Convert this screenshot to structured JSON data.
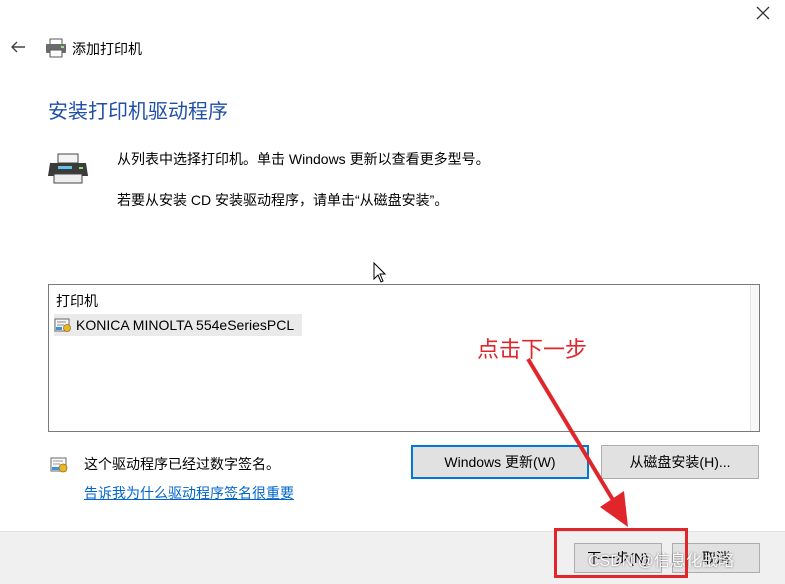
{
  "window": {
    "title": "添加打印机"
  },
  "page": {
    "heading": "安装打印机驱动程序",
    "description_line1": "从列表中选择打印机。单击 Windows 更新以查看更多型号。",
    "description_line2": "若要从安装 CD 安装驱动程序，请单击“从磁盘安装”。"
  },
  "printer_list": {
    "header": "打印机",
    "items": [
      {
        "label": "KONICA MINOLTA 554eSeriesPCL",
        "selected": true
      }
    ]
  },
  "signature": {
    "status_text": "这个驱动程序已经过数字签名。",
    "link_text": "告诉我为什么驱动程序签名很重要"
  },
  "buttons": {
    "windows_update": "Windows 更新(W)",
    "have_disk": "从磁盘安装(H)...",
    "next": "下一步(N)",
    "cancel": "取消"
  },
  "annotation": {
    "text": "点击下一步",
    "color": "#e0262b"
  },
  "watermark": "CSDN @信息化战略",
  "colors": {
    "heading": "#1f4fa8",
    "link": "#0066cc",
    "focus_border": "#0078d7",
    "footer": "#f0f0f0"
  },
  "icons": {
    "close": "close-icon",
    "back": "back-arrow-icon",
    "printer": "printer-icon",
    "certificate": "certificate-icon"
  }
}
